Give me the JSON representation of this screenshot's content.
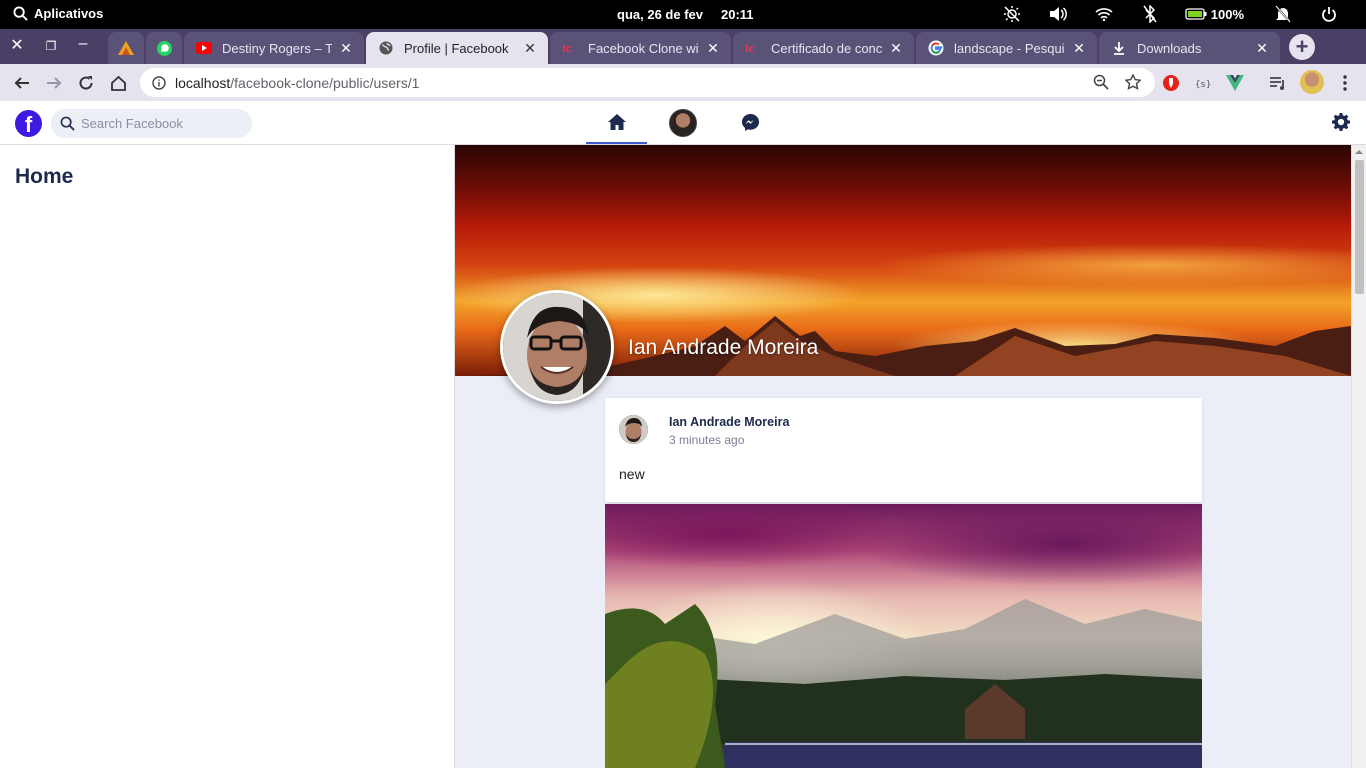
{
  "os": {
    "apps_label": "Aplicativos",
    "date": "qua, 26 de fev",
    "time": "20:11",
    "battery_pct": "100%"
  },
  "tabs": [
    {
      "title": "",
      "icon": "sicredi-icon",
      "pinned": true
    },
    {
      "title": "",
      "icon": "whatsapp-icon",
      "pinned": true
    },
    {
      "title": "Destiny Rogers – Tom",
      "icon": "youtube-icon"
    },
    {
      "title": "Profile | Facebook",
      "icon": "globe-icon",
      "active": true
    },
    {
      "title": "Facebook Clone with",
      "icon": "laravel-icon"
    },
    {
      "title": "Certificado de conclu",
      "icon": "laravel-icon"
    },
    {
      "title": "landscape - Pesquisa",
      "icon": "google-icon"
    },
    {
      "title": "Downloads",
      "icon": "download-icon"
    }
  ],
  "address": {
    "host": "localhost",
    "path": "/facebook-clone/public/users/1"
  },
  "fb": {
    "search_placeholder": "Search Facebook"
  },
  "sidebar": {
    "title": "Home"
  },
  "profile": {
    "name": "Ian Andrade Moreira"
  },
  "post": {
    "author": "Ian Andrade Moreira",
    "time": "3 minutes ago",
    "body": "new"
  },
  "colors": {
    "fb_accent": "#3f1ae0",
    "tab_strip": "#4a4066",
    "toolbar": "#e6e2ee",
    "nav_underline": "#3c5ccf"
  }
}
